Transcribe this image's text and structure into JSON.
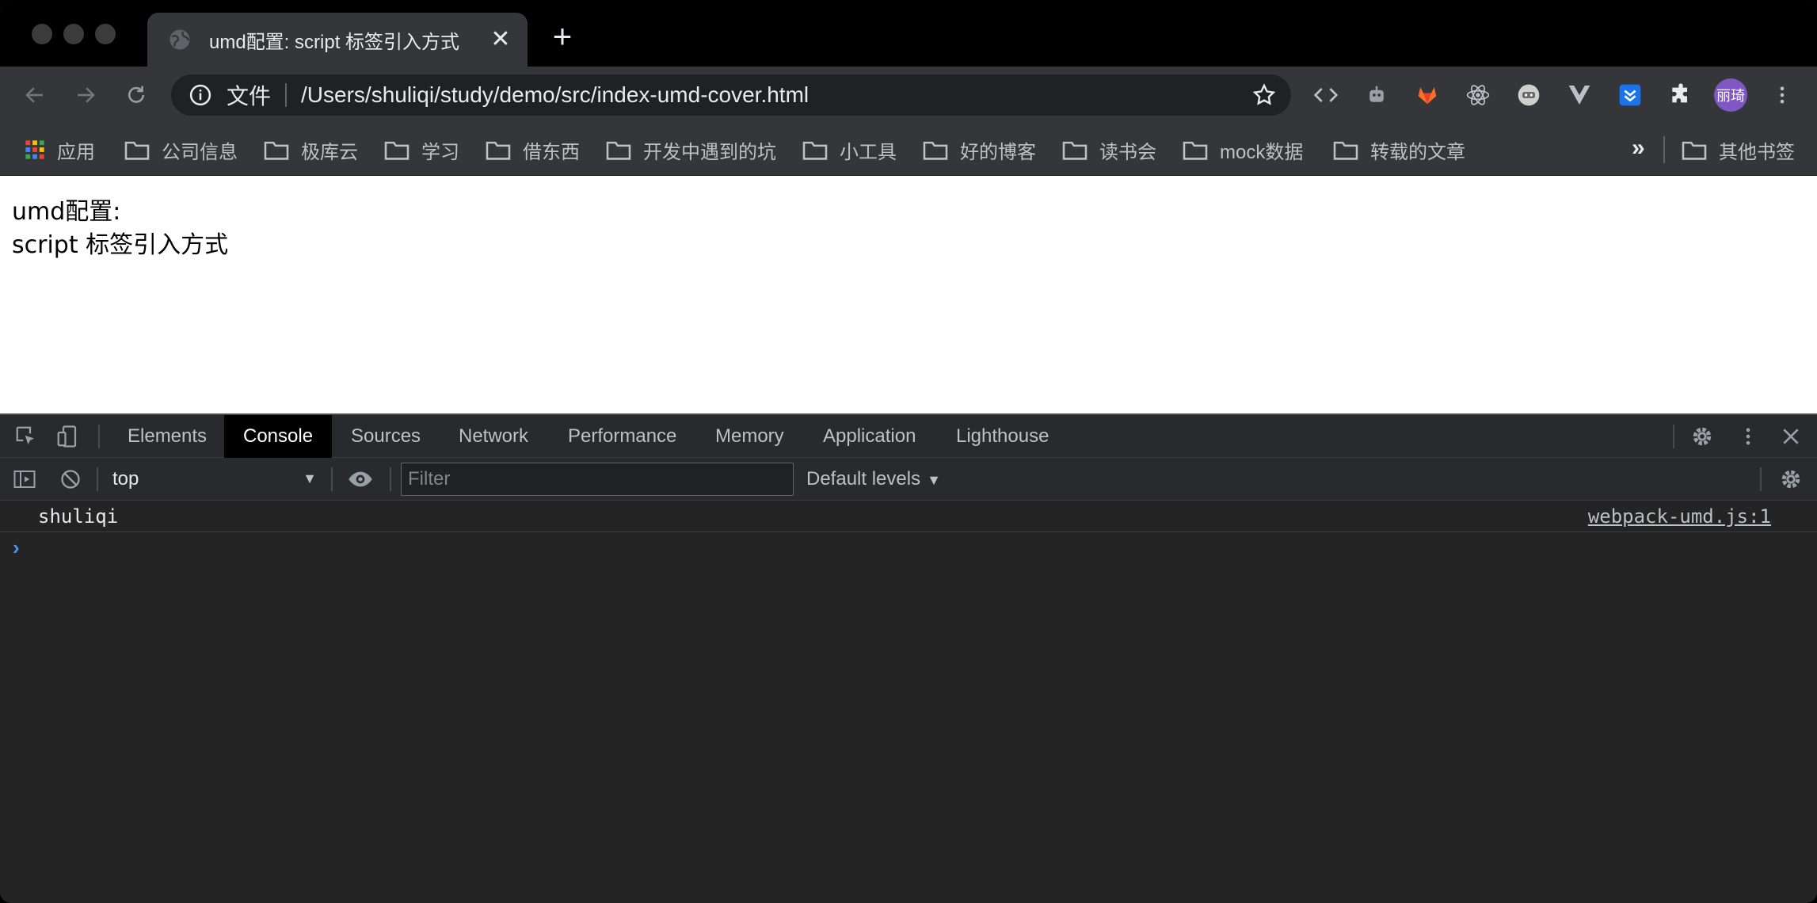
{
  "tab": {
    "title": "umd配置: script 标签引入方式",
    "close": "✕",
    "new_tab": "+"
  },
  "omnibox": {
    "scheme_label": "文件",
    "url": "/Users/shuliqi/study/demo/src/index-umd-cover.html"
  },
  "profile": {
    "initials": "丽琦"
  },
  "bookmarks": {
    "items": [
      {
        "label": "应用",
        "icon": "apps-grid-icon"
      },
      {
        "label": "公司信息",
        "icon": "folder-icon"
      },
      {
        "label": "极库云",
        "icon": "folder-icon"
      },
      {
        "label": "学习",
        "icon": "folder-icon"
      },
      {
        "label": "借东西",
        "icon": "folder-icon"
      },
      {
        "label": "开发中遇到的坑",
        "icon": "folder-icon"
      },
      {
        "label": "小工具",
        "icon": "folder-icon"
      },
      {
        "label": "好的博客",
        "icon": "folder-icon"
      },
      {
        "label": "读书会",
        "icon": "folder-icon"
      },
      {
        "label": "mock数据",
        "icon": "folder-icon"
      },
      {
        "label": "转载的文章",
        "icon": "folder-icon"
      }
    ],
    "more": "»",
    "other": "其他书签"
  },
  "page": {
    "line1": "umd配置:",
    "line2": "script 标签引入方式"
  },
  "devtools": {
    "tabs": [
      "Elements",
      "Console",
      "Sources",
      "Network",
      "Performance",
      "Memory",
      "Application",
      "Lighthouse"
    ],
    "active_tab": "Console",
    "context": "top",
    "filter_placeholder": "Filter",
    "levels": "Default levels",
    "log": {
      "message": "shuliqi",
      "source": "webpack-umd.js:1"
    },
    "prompt": "›"
  },
  "colors": {
    "chrome_dark": "#35363a",
    "omnibox_bg": "#202124",
    "devtools_bg": "#242424",
    "prompt_blue": "#4f8ff7",
    "avatar_purple": "#7e57c2"
  }
}
